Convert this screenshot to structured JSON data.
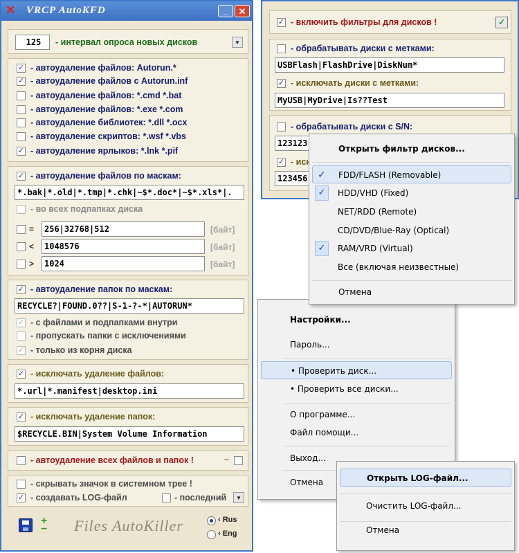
{
  "main_window": {
    "title": "VRCP AutoKFD",
    "interval": {
      "value": "125",
      "label": "- интервал опроса новых дисков"
    },
    "autodel": [
      {
        "label": "- автоудаление файлов:  Autorun.*",
        "checked": true
      },
      {
        "label": "- автоудаление файлов с Autorun.inf",
        "checked": true
      },
      {
        "label": "- автоудаление файлов:  *.cmd  *.bat",
        "checked": false
      },
      {
        "label": "- автоудаление файлов:  *.exe  *.com",
        "checked": false
      },
      {
        "label": "- автоудаление библиотек:  *.dll  *.ocx",
        "checked": false
      },
      {
        "label": "- автоудаление скриптов:  *.wsf  *.vbs",
        "checked": false
      },
      {
        "label": "- автоудаление ярлыков:  *.lnk  *.pif",
        "checked": true
      }
    ],
    "mask_files": {
      "label": "- автоудаление файлов по маскам:",
      "value": "*.bak|*.old|*.tmp|*.chk|~$*.doc*|~$*.xls*|.",
      "subfolders": "- во всех подпапках диска",
      "sizes": [
        {
          "sym": "=",
          "value": "256|32768|512",
          "unit": "[байт]"
        },
        {
          "sym": "<",
          "value": "1048576",
          "unit": "[байт]"
        },
        {
          "sym": ">",
          "value": "1024",
          "unit": "[байт]"
        }
      ]
    },
    "mask_folders": {
      "label": "- автоудаление папок по маскам:",
      "value": "RECYCLE?|FOUND.0??|S-1-?-*|AUTORUN*",
      "opts": [
        {
          "label": "- с файлами и подпапками внутри",
          "checked": true
        },
        {
          "label": "- пропускать папки с исключениями",
          "checked": false
        },
        {
          "label": "- только из корня диска",
          "checked": true
        }
      ]
    },
    "excl_files": {
      "label": "- исключать удаление файлов:",
      "value": "*.url|*.manifest|desktop.ini"
    },
    "excl_folders": {
      "label": "- исключать удаление папок:",
      "value": "$RECYCLE.BIN|System Volume Information"
    },
    "delete_all": {
      "label": "- автоудаление всех файлов и папок !",
      "tilde": "~"
    },
    "tray": "- скрывать значок в системном трее !",
    "log": "- создавать LOG-файл",
    "last": "- последний",
    "footer": {
      "logo": "Files AutoKiller",
      "lang1": "‹ Rus",
      "lang2": "‹ Eng"
    }
  },
  "filter_window": {
    "enable": "- включить фильтры для дисков !",
    "labels_proc": "- обрабатывать диски с метками:",
    "labels_proc_value": "USBFlash|FlashDrive|DiskNum*",
    "labels_excl": "- исключать диски с метками:",
    "labels_excl_value": "MyUSB|MyDrive|Is??Test",
    "sn_proc": "- обрабатывать диски с S/N:",
    "sn_value1": "123123",
    "sn_excl_partial": "- иск",
    "sn_value2": "123456"
  },
  "filter_menu": {
    "title": "Открыть фильтр дисков...",
    "items": [
      {
        "label": "FDD/FLASH  (Removable)",
        "checked": true
      },
      {
        "label": "HDD/VHD  (Fixed)",
        "checked": true
      },
      {
        "label": "NET/RDD  (Remote)",
        "checked": false
      },
      {
        "label": "CD/DVD/Blue-Ray  (Optical)",
        "checked": false
      },
      {
        "label": "RAM/VRD  (Virtual)",
        "checked": true
      },
      {
        "label": "Все  (включая неизвестные)",
        "checked": false
      }
    ],
    "cancel": "Отмена",
    "check_glyph": "✓"
  },
  "tray_menu": {
    "settings": "Настройки...",
    "password": "Пароль...",
    "check_disk": "• Проверить диск...",
    "check_all": "• Проверить все диски...",
    "about": "О программе...",
    "help": "Файл помощи...",
    "exit": "Выход...",
    "cancel": "Отмена"
  },
  "log_menu": {
    "open": "Открыть LOG-файл...",
    "clear": "Очистить LOG-файл...",
    "cancel": "Отмена"
  },
  "colors": {
    "titlebar": "#3d72c4",
    "panel": "#ece5cf",
    "label_blue": "#141e6e",
    "label_red": "#a51818",
    "label_green": "#1b6b1b"
  }
}
